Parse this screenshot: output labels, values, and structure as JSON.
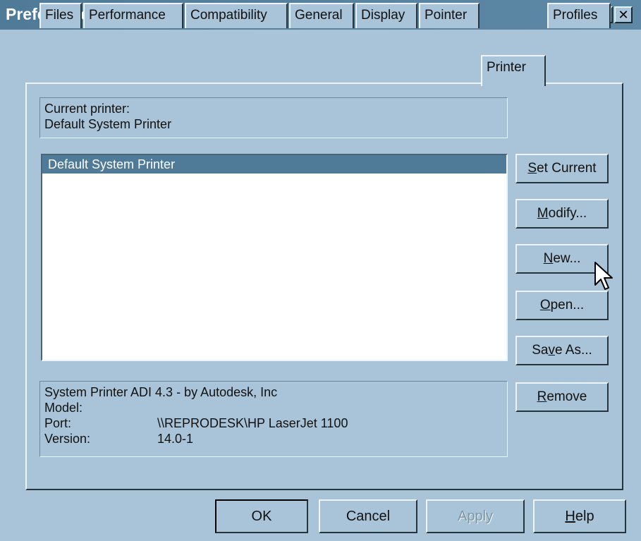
{
  "window": {
    "title": "Preferences",
    "help_glyph": "?",
    "close_glyph": "✕"
  },
  "tabs": [
    {
      "label": "Files"
    },
    {
      "label": "Performance"
    },
    {
      "label": "Compatibility"
    },
    {
      "label": "General"
    },
    {
      "label": "Display"
    },
    {
      "label": "Pointer"
    },
    {
      "label": "Printer"
    },
    {
      "label": "Profiles"
    }
  ],
  "current_printer": {
    "label": "Current printer:",
    "value": "Default System Printer"
  },
  "printer_list": {
    "items": [
      {
        "label": "Default System Printer",
        "selected": true
      }
    ]
  },
  "side_buttons": {
    "set_current": "Set Current",
    "modify": "Modify...",
    "new": "New...",
    "open": "Open...",
    "save_as": "Save As...",
    "remove": "Remove"
  },
  "printer_info": {
    "description": "System Printer ADI 4.3 - by Autodesk, Inc",
    "model_label": "Model:",
    "model_value": "",
    "port_label": "Port:",
    "port_value": "\\\\REPRODESK\\HP LaserJet 1100",
    "version_label": "Version:",
    "version_value": "14.0-1"
  },
  "bottom_buttons": {
    "ok": "OK",
    "cancel": "Cancel",
    "apply": "Apply",
    "help": "Help"
  },
  "colors": {
    "face": "#a9c4d8",
    "titlebar": "#4f7a98",
    "selection": "#4f7a98"
  }
}
